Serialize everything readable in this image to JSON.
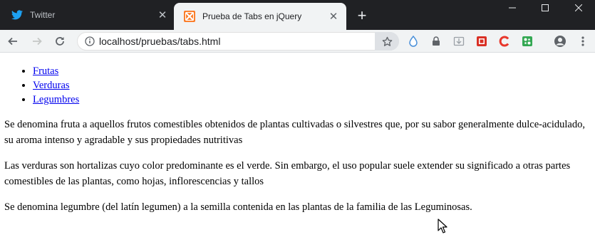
{
  "browser": {
    "tabs": [
      {
        "title": "Twitter",
        "icon": "twitter-icon",
        "active": false
      },
      {
        "title": "Prueba de Tabs en jQuery",
        "icon": "xampp-icon",
        "active": true
      }
    ],
    "new_tab_label": "+",
    "address": "localhost/pruebas/tabs.html",
    "colors": {
      "tabstrip": "#202124",
      "toolbar": "#f1f3f4",
      "twitter": "#1da1f2",
      "xampp": "#fb7a24"
    }
  },
  "page": {
    "nav": [
      "Frutas",
      "Verduras",
      "Legumbres"
    ],
    "paragraphs": [
      "Se denomina fruta a aquellos frutos comestibles obtenidos de plantas cultivadas o silvestres que, por su sabor generalmente dulce-acidulado, su aroma intenso y agradable y sus propiedades nutritivas",
      "Las verduras son hortalizas cuyo color predominante es el verde. Sin embargo, el uso popular suele extender su significado a otras partes comestibles de las plantas, como hojas, inflorescencias y tallos",
      "Se denomina legumbre (del latín legumen) a la semilla contenida en las plantas de la familia de las Leguminosas."
    ]
  }
}
